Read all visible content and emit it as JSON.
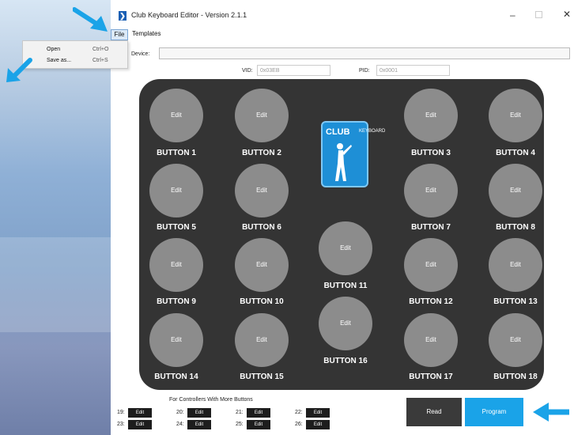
{
  "window": {
    "title": "Club Keyboard Editor - Version 2.1.1",
    "icon_glyph": "❯",
    "min_glyph": "–",
    "close_glyph": "✕"
  },
  "menu": {
    "file": "File",
    "templates": "Templates"
  },
  "file_menu": [
    {
      "label": "Open",
      "shortcut": "Ctrl+O"
    },
    {
      "label": "Save as...",
      "shortcut": "Ctrl+S"
    }
  ],
  "device": {
    "label": "Device:",
    "value": ""
  },
  "vid": {
    "label": "VID:",
    "placeholder": "0x03EB"
  },
  "pid": {
    "label": "PID:",
    "placeholder": "0x0001"
  },
  "buttons": [
    {
      "label": "BUTTON 1",
      "action": "Edit"
    },
    {
      "label": "BUTTON 2",
      "action": "Edit"
    },
    {
      "label": "BUTTON 3",
      "action": "Edit"
    },
    {
      "label": "BUTTON 4",
      "action": "Edit"
    },
    {
      "label": "BUTTON 5",
      "action": "Edit"
    },
    {
      "label": "BUTTON 6",
      "action": "Edit"
    },
    {
      "label": "BUTTON 7",
      "action": "Edit"
    },
    {
      "label": "BUTTON 8",
      "action": "Edit"
    },
    {
      "label": "BUTTON 9",
      "action": "Edit"
    },
    {
      "label": "BUTTON 10",
      "action": "Edit"
    },
    {
      "label": "BUTTON 11",
      "action": "Edit"
    },
    {
      "label": "BUTTON 12",
      "action": "Edit"
    },
    {
      "label": "BUTTON 13",
      "action": "Edit"
    },
    {
      "label": "BUTTON 14",
      "action": "Edit"
    },
    {
      "label": "BUTTON 15",
      "action": "Edit"
    },
    {
      "label": "BUTTON 16",
      "action": "Edit"
    },
    {
      "label": "BUTTON 17",
      "action": "Edit"
    },
    {
      "label": "BUTTON 18",
      "action": "Edit"
    }
  ],
  "logo": {
    "club": "CLUB",
    "keyboard": "KEYBOARD"
  },
  "extra": {
    "title": "For Controllers With More Buttons",
    "items": [
      {
        "num": "19:",
        "label": "Edit"
      },
      {
        "num": "20:",
        "label": "Edit"
      },
      {
        "num": "21:",
        "label": "Edit"
      },
      {
        "num": "22:",
        "label": "Edit"
      },
      {
        "num": "23:",
        "label": "Edit"
      },
      {
        "num": "24:",
        "label": "Edit"
      },
      {
        "num": "25:",
        "label": "Edit"
      },
      {
        "num": "26:",
        "label": "Edit"
      }
    ]
  },
  "actions": {
    "read": "Read",
    "program": "Program"
  },
  "colors": {
    "panel": "#343434",
    "circle": "#8c8c8c",
    "program": "#1aa3e8",
    "arrow": "#1aa3e8",
    "logo": "#1e8fd6"
  }
}
